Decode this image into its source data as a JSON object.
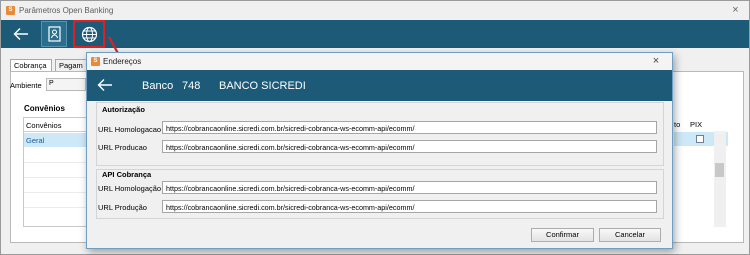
{
  "parent_window": {
    "title": "Parâmetros Open Banking",
    "close_glyph": "×",
    "tabs": [
      "Cobrança",
      "Pagam"
    ],
    "ambiente_label": "Ambiente",
    "ambiente_value": "P",
    "convenios_heading": "Convênios",
    "convenios_column": "Convênios",
    "convenios_rows": [
      "Geral"
    ],
    "right_columns": [
      "to",
      "PIX"
    ]
  },
  "dialog": {
    "title": "Endereços",
    "close_glyph": "×",
    "banco_label": "Banco",
    "banco_code": "748",
    "banco_name": "BANCO SICREDI",
    "autorizacao": {
      "title": "Autorização",
      "homologacao_label": "URL Homologacao",
      "homologacao_value": "https://cobrancaonline.sicredi.com.br/sicredi-cobranca-ws-ecomm-api/ecomm/",
      "producao_label": "URL Producao",
      "producao_value": "https://cobrancaonline.sicredi.com.br/sicredi-cobranca-ws-ecomm-api/ecomm/"
    },
    "api_cobranca": {
      "title": "API Cobrança",
      "homologacao_label": "URL Homologação",
      "homologacao_value": "https://cobrancaonline.sicredi.com.br/sicredi-cobranca-ws-ecomm-api/ecomm/",
      "producao_label": "URL Produção",
      "producao_value": "https://cobrancaonline.sicredi.com.br/sicredi-cobranca-ws-ecomm-api/ecomm/"
    },
    "confirm_label": "Confirmar",
    "cancel_label": "Cancelar"
  },
  "colors": {
    "header_blue": "#1d5a78",
    "highlight_red": "#e02020",
    "selection_blue": "#cde8f6"
  }
}
